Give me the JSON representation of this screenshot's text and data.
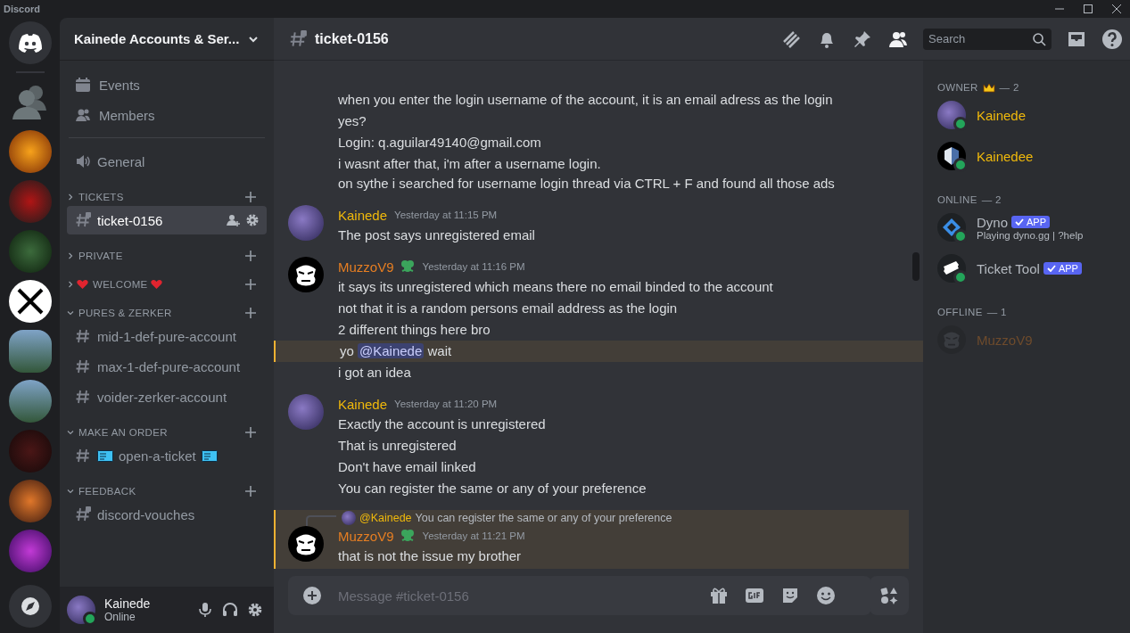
{
  "title_bar": {
    "title": "Discord"
  },
  "server_header": {
    "name": "Kainede Accounts & Ser..."
  },
  "nav": [
    {
      "kind": "events",
      "label": "Events"
    },
    {
      "kind": "members",
      "label": "Members"
    }
  ],
  "channels": [
    {
      "kind": "voice",
      "name": "General",
      "selected": false
    }
  ],
  "categories": [
    {
      "name": "TICKETS",
      "expanded": false,
      "heart_icons": false,
      "channels": [
        {
          "kind": "private",
          "name": "ticket-0156",
          "selected": true,
          "ticket_icons": false
        }
      ]
    },
    {
      "name": "PRIVATE",
      "expanded": false,
      "heart_icons": false
    },
    {
      "name": "WELCOME",
      "expanded": false,
      "heart_icons": true
    },
    {
      "name": "PURES & ZERKER",
      "expanded": true,
      "heart_icons": false,
      "channels": [
        {
          "kind": "text",
          "name": "mid-1-def-pure-account",
          "selected": false,
          "ticket_icons": false
        },
        {
          "kind": "text",
          "name": "max-1-def-pure-account",
          "selected": false,
          "ticket_icons": false
        },
        {
          "kind": "text",
          "name": "voider-zerker-account",
          "selected": false,
          "ticket_icons": false
        }
      ]
    },
    {
      "name": "MAKE AN ORDER",
      "expanded": true,
      "heart_icons": false,
      "channels": [
        {
          "kind": "text",
          "name": "open-a-ticket",
          "selected": false,
          "ticket_icons": true
        }
      ]
    },
    {
      "name": "FEEDBACK",
      "expanded": true,
      "heart_icons": false,
      "channels": [
        {
          "kind": "private",
          "name": "discord-vouches",
          "selected": false,
          "ticket_icons": false
        }
      ]
    }
  ],
  "user_panel": {
    "name": "Kainede",
    "status": "Online"
  },
  "chat_header": {
    "channel": "ticket-0156"
  },
  "search": {
    "placeholder": "Search"
  },
  "messages": [
    {
      "lines": [
        {
          "text": "when you enter the login username of the account, it is an email adress as the login",
          "highlighted": false
        },
        {
          "text": "yes?",
          "highlighted": false
        },
        {
          "text": "Login: q.aguilar49140@gmail.com",
          "highlighted": false
        },
        {
          "text": "i wasnt after that, i'm after a username login.\non sythe i searched for username login thread via CTRL + F and found all those ads",
          "highlighted": false
        }
      ]
    },
    {
      "kind": "character",
      "author": "Kainede",
      "color": "#f0b90b",
      "role_icon": false,
      "time": "Yesterday at 11:15 PM",
      "lines": [
        {
          "text": "The post says unregistered email",
          "highlighted": false
        }
      ]
    },
    {
      "kind": "gorilla",
      "author": "MuzzoV9",
      "color": "#e67e22",
      "role_icon": true,
      "time": "Yesterday at 11:16 PM",
      "lines": [
        {
          "text": "it says its unregistered which means there no email binded to the account",
          "highlighted": false
        },
        {
          "text": "not that it is a random persons email address as the login",
          "highlighted": false
        },
        {
          "text": "2 different things here bro",
          "highlighted": false
        },
        {
          "text": "yo ",
          "mention": "@Kainede",
          "rest": " wait",
          "highlighted": true
        },
        {
          "text": "i got an idea",
          "highlighted": false
        }
      ]
    },
    {
      "kind": "character",
      "author": "Kainede",
      "color": "#f0b90b",
      "role_icon": false,
      "time": "Yesterday at 11:20 PM",
      "lines": [
        {
          "text": "Exactly the account is unregistered",
          "highlighted": false
        },
        {
          "text": "That is unregistered",
          "highlighted": false
        },
        {
          "text": "Don't have email linked",
          "highlighted": false
        },
        {
          "text": "You can register the same or any of your preference",
          "highlighted": false
        }
      ]
    },
    {
      "kind": "gorilla",
      "author": "MuzzoV9",
      "color": "#e67e22",
      "role_icon": true,
      "time": "Yesterday at 11:21 PM",
      "highlighted": true,
      "reply": {
        "mention": "@Kainede",
        "text": "You can register the same or any of your preference"
      },
      "lines": [
        {
          "text": "that is not the issue my brother"
        }
      ]
    }
  ],
  "composer": {
    "placeholder": "Message #ticket-0156"
  },
  "member_sections": [
    {
      "title": "OWNER",
      "crown": true,
      "count": "— 2",
      "members": [
        {
          "kind": "character",
          "name": "Kainede",
          "color": "#f0b90b",
          "online": true
        },
        {
          "kind": "wings",
          "name": "Kainedee",
          "color": "#f0b90b",
          "online": true
        }
      ]
    },
    {
      "title": "ONLINE",
      "crown": false,
      "count": "— 2",
      "members": [
        {
          "kind": "diamond",
          "name": "Dyno",
          "color": "#b5bac1",
          "online": true,
          "tag": "APP",
          "activity": "Playing dyno.gg | ?help"
        },
        {
          "kind": "ticket",
          "name": "Ticket Tool",
          "color": "#b5bac1",
          "online": true,
          "tag": "APP"
        }
      ]
    },
    {
      "title": "OFFLINE",
      "crown": false,
      "count": "— 1",
      "members": [
        {
          "kind": "gorilla",
          "name": "MuzzoV9",
          "color": "#6e4b2c",
          "online": false
        }
      ]
    }
  ]
}
